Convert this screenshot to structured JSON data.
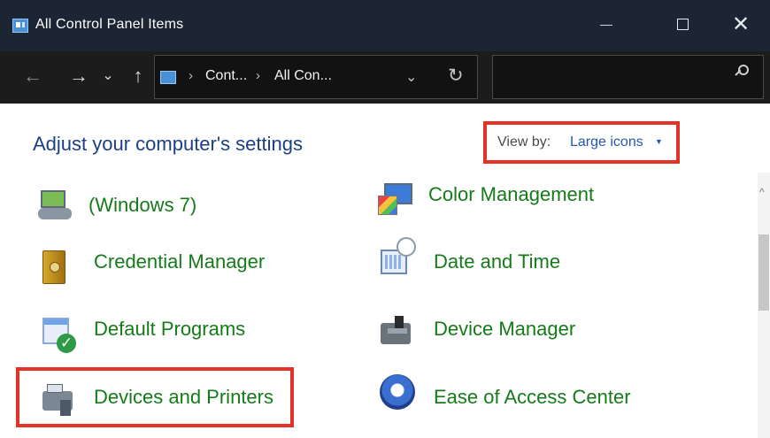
{
  "window": {
    "title": "All Control Panel Items",
    "minimize_glyph": "—",
    "maximize_glyph": "",
    "close_glyph": "✕"
  },
  "navigation": {
    "back_glyph": "←",
    "forward_glyph": "→",
    "recent_glyph": "⌄",
    "up_glyph": "↑"
  },
  "address": {
    "breadcrumb": [
      "Cont...",
      "All Con..."
    ],
    "separator": "›",
    "dropdown_glyph": "⌄",
    "refresh_glyph": "↻"
  },
  "search": {
    "placeholder": ""
  },
  "main": {
    "heading": "Adjust your computer's settings",
    "view_by_label": "View by:",
    "view_by_value": "Large icons",
    "view_by_caret": "▼"
  },
  "items": [
    {
      "label": "(Windows 7)",
      "icon": "backup-icon",
      "column": 1
    },
    {
      "label": "Color Management",
      "icon": "color-management-icon",
      "column": 2
    },
    {
      "label": "Credential Manager",
      "icon": "credential-manager-icon",
      "column": 1
    },
    {
      "label": "Date and Time",
      "icon": "date-time-icon",
      "column": 2
    },
    {
      "label": "Default Programs",
      "icon": "default-programs-icon",
      "column": 1
    },
    {
      "label": "Device Manager",
      "icon": "device-manager-icon",
      "column": 2
    },
    {
      "label": "Devices and Printers",
      "icon": "devices-printers-icon",
      "column": 1
    },
    {
      "label": "Ease of Access Center",
      "icon": "ease-access-icon",
      "column": 2
    }
  ],
  "colors": {
    "titlebar": "#1b2533",
    "addressbar": "#1c1c1c",
    "link_blue": "#2557b4",
    "item_green": "#157b19",
    "highlight_red": "#e53228"
  }
}
